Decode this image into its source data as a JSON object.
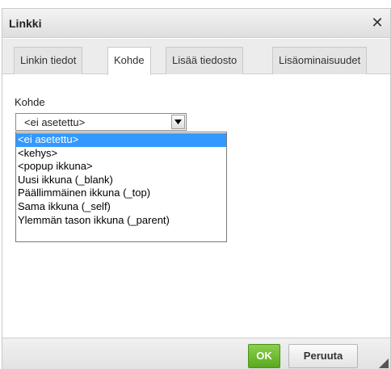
{
  "dialog": {
    "title": "Linkki",
    "close_glyph": "✕"
  },
  "tabs": [
    {
      "label": "Linkin tiedot",
      "active": false
    },
    {
      "label": "Kohde",
      "active": true
    },
    {
      "label": "Lisää tiedosto",
      "active": false
    },
    {
      "label": "Lisäominaisuudet",
      "active": false
    }
  ],
  "target": {
    "label": "Kohde",
    "selected_value": "<ei asetettu>",
    "options": [
      "<ei asetettu>",
      "<kehys>",
      "<popup ikkuna>",
      "Uusi ikkuna (_blank)",
      "Päällimmäinen ikkuna (_top)",
      "Sama ikkuna (_self)",
      "Ylemmän tason ikkuna (_parent)"
    ],
    "highlighted_index": 0
  },
  "footer": {
    "ok_label": "OK",
    "cancel_label": "Peruuta"
  },
  "colors": {
    "ok_button": "#5aa81f",
    "highlight": "#3399ff"
  }
}
